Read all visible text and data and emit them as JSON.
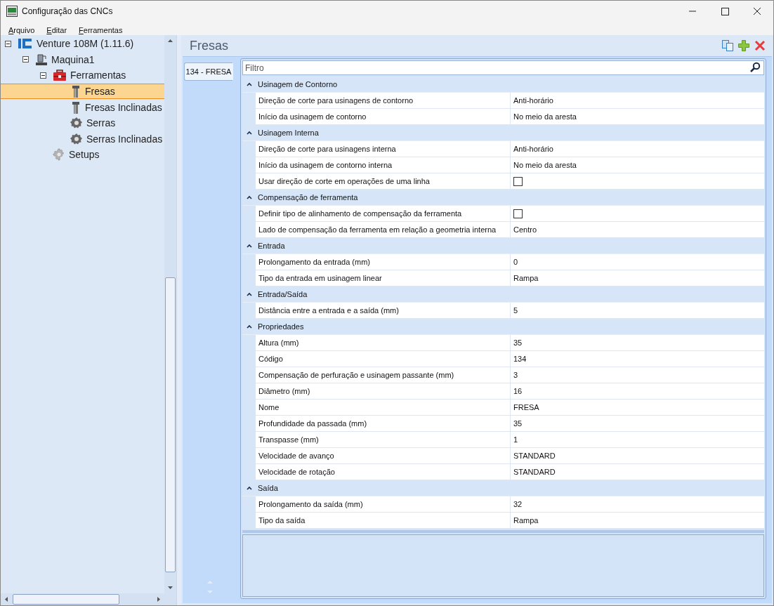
{
  "window": {
    "title": "Configuração das CNCs"
  },
  "menu": [
    "Arquivo",
    "Editar",
    "Ferramentas"
  ],
  "tree": [
    {
      "label": "Venture 108M (1.11.6)",
      "kind": "brand",
      "expanded": true,
      "selected": false,
      "children": [
        {
          "label": "Maquina1",
          "kind": "machine",
          "expanded": true,
          "selected": false,
          "children": [
            {
              "label": "Ferramentas",
              "kind": "toolbox",
              "expanded": true,
              "selected": false,
              "children": [
                {
                  "label": "Fresas",
                  "kind": "mill",
                  "selected": true
                },
                {
                  "label": "Fresas Inclinadas",
                  "kind": "mill",
                  "selected": false
                },
                {
                  "label": "Serras",
                  "kind": "saw",
                  "selected": false
                },
                {
                  "label": "Serras Inclinadas",
                  "kind": "saw",
                  "selected": false
                }
              ]
            },
            {
              "label": "Setups",
              "kind": "gear",
              "selected": false
            }
          ]
        }
      ]
    }
  ],
  "panel": {
    "title": "Fresas"
  },
  "tabs": [
    {
      "label": "134 - FRESA",
      "selected": true
    }
  ],
  "filter": {
    "placeholder": "Filtro"
  },
  "categories": [
    {
      "name": "Usinagem de Contorno",
      "expanded": true,
      "rows": [
        {
          "name": "Direção de corte para usinagens de contorno",
          "kind": "text",
          "value": "Anti-horário"
        },
        {
          "name": "Início da usinagem de contorno",
          "kind": "text",
          "value": "No meio da aresta"
        }
      ]
    },
    {
      "name": "Usinagem Interna",
      "expanded": true,
      "rows": [
        {
          "name": "Direção de corte para usinagens interna",
          "kind": "text",
          "value": "Anti-horário"
        },
        {
          "name": "Início da usinagem de contorno interna",
          "kind": "text",
          "value": "No meio da aresta"
        },
        {
          "name": "Usar direção de corte em operações de uma linha",
          "kind": "checkbox",
          "checked": false
        }
      ]
    },
    {
      "name": "Compensação de ferramenta",
      "expanded": true,
      "rows": [
        {
          "name": "Definir tipo de alinhamento de compensação da ferramenta",
          "kind": "checkbox",
          "checked": false
        },
        {
          "name": "Lado de compensação da ferramenta em relação a geometria interna",
          "kind": "text",
          "value": "Centro"
        }
      ]
    },
    {
      "name": "Entrada",
      "expanded": true,
      "rows": [
        {
          "name": "Prolongamento da entrada (mm)",
          "kind": "text",
          "value": "0"
        },
        {
          "name": "Tipo da entrada em usinagem linear",
          "kind": "text",
          "value": "Rampa"
        }
      ]
    },
    {
      "name": "Entrada/Saída",
      "expanded": true,
      "rows": [
        {
          "name": "Distância entre a entrada e a saída (mm)",
          "kind": "text",
          "value": "5"
        }
      ]
    },
    {
      "name": "Propriedades",
      "expanded": true,
      "rows": [
        {
          "name": "Altura (mm)",
          "kind": "text",
          "value": "35"
        },
        {
          "name": "Código",
          "kind": "text",
          "value": "134"
        },
        {
          "name": "Compensação de perfuração e usinagem passante (mm)",
          "kind": "text",
          "value": "3"
        },
        {
          "name": "Diâmetro (mm)",
          "kind": "text",
          "value": "16"
        },
        {
          "name": "Nome",
          "kind": "text",
          "value": "FRESA"
        },
        {
          "name": "Profundidade da passada (mm)",
          "kind": "text",
          "value": "35"
        },
        {
          "name": "Transpasse (mm)",
          "kind": "text",
          "value": "1"
        },
        {
          "name": "Velocidade de avanço",
          "kind": "text",
          "value": "STANDARD"
        },
        {
          "name": "Velocidade de rotação",
          "kind": "text",
          "value": "STANDARD"
        }
      ]
    },
    {
      "name": "Saída",
      "expanded": true,
      "rows": [
        {
          "name": "Prolongamento da saída (mm)",
          "kind": "text",
          "value": "32"
        },
        {
          "name": "Tipo da saída",
          "kind": "text",
          "value": "Rampa"
        }
      ]
    }
  ]
}
